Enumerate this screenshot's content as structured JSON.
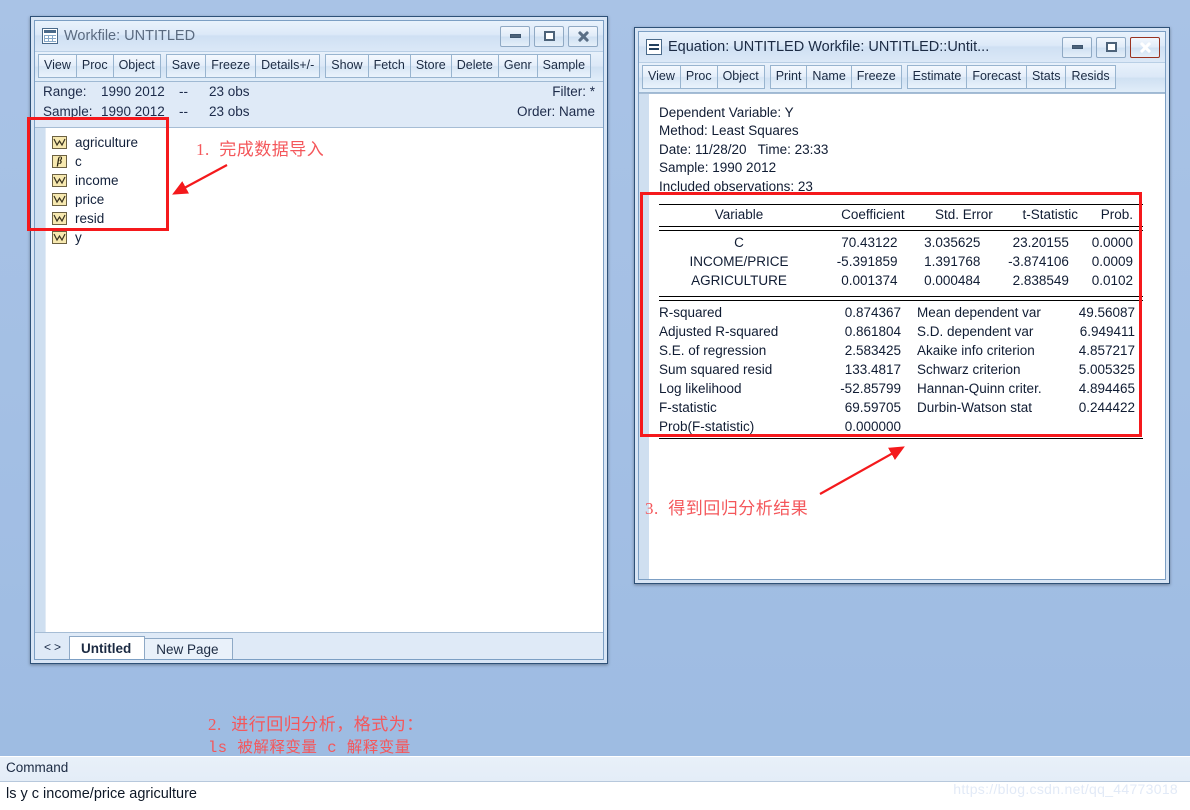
{
  "desktop": {
    "watermark": "https://blog.csdn.net/qq_44773018"
  },
  "workfile_window": {
    "title": "Workfile: UNTITLED",
    "icon": "grid-icon",
    "buttons": {
      "minimize": "minimize-icon",
      "maximize": "maximize-icon",
      "close": "close-icon"
    },
    "toolbar_group1": [
      "View",
      "Proc",
      "Object"
    ],
    "toolbar_group2": [
      "Save",
      "Freeze",
      "Details+/-"
    ],
    "toolbar_group3": [
      "Show",
      "Fetch",
      "Store",
      "Delete",
      "Genr",
      "Sample"
    ],
    "info": {
      "range_label": "Range:",
      "range_value": "1990 2012",
      "range_dash": "--",
      "range_obs": "23 obs",
      "filter_label": "Filter: *",
      "sample_label": "Sample:",
      "sample_value": "1990 2012",
      "sample_dash": "--",
      "sample_obs": "23 obs",
      "order_label": "Order: Name"
    },
    "objects": [
      {
        "name": "agriculture",
        "icon": "series-icon"
      },
      {
        "name": "c",
        "icon": "coefficient-beta-icon"
      },
      {
        "name": "income",
        "icon": "series-icon"
      },
      {
        "name": "price",
        "icon": "series-icon"
      },
      {
        "name": "resid",
        "icon": "series-icon"
      },
      {
        "name": "y",
        "icon": "series-icon"
      }
    ],
    "tabs": {
      "nav_prev": "<",
      "nav_next": ">",
      "items": [
        {
          "label": "Untitled",
          "selected": true
        },
        {
          "label": "New Page",
          "selected": false
        }
      ]
    }
  },
  "equation_window": {
    "title": "Equation: UNTITLED   Workfile: UNTITLED::Untit...",
    "icon": "equation-icon",
    "buttons": {
      "minimize": "minimize-icon",
      "maximize": "maximize-icon",
      "close": "close-icon"
    },
    "toolbar_group1": [
      "View",
      "Proc",
      "Object"
    ],
    "toolbar_group2": [
      "Print",
      "Name",
      "Freeze"
    ],
    "toolbar_group3": [
      "Estimate",
      "Forecast",
      "Stats",
      "Resids"
    ],
    "header_lines": [
      "Dependent Variable: Y",
      "Method: Least Squares",
      "Date: 11/28/20   Time: 23:33",
      "Sample: 1990 2012",
      "Included observations: 23"
    ],
    "regression": {
      "columns": [
        "Variable",
        "Coefficient",
        "Std. Error",
        "t-Statistic",
        "Prob."
      ],
      "rows": [
        {
          "variable": "C",
          "coefficient": "70.43122",
          "std_error": "3.035625",
          "t_statistic": "23.20155",
          "prob": "0.0000"
        },
        {
          "variable": "INCOME/PRICE",
          "coefficient": "-5.391859",
          "std_error": "1.391768",
          "t_statistic": "-3.874106",
          "prob": "0.0009"
        },
        {
          "variable": "AGRICULTURE",
          "coefficient": "0.001374",
          "std_error": "0.000484",
          "t_statistic": "2.838549",
          "prob": "0.0102"
        }
      ],
      "stats": [
        {
          "left_label": "R-squared",
          "left_value": "0.874367",
          "right_label": "Mean dependent var",
          "right_value": "49.56087"
        },
        {
          "left_label": "Adjusted R-squared",
          "left_value": "0.861804",
          "right_label": "S.D. dependent var",
          "right_value": "6.949411"
        },
        {
          "left_label": "S.E. of regression",
          "left_value": "2.583425",
          "right_label": "Akaike info criterion",
          "right_value": "4.857217"
        },
        {
          "left_label": "Sum squared resid",
          "left_value": "133.4817",
          "right_label": "Schwarz criterion",
          "right_value": "5.005325"
        },
        {
          "left_label": "Log likelihood",
          "left_value": "-52.85799",
          "right_label": "Hannan-Quinn criter.",
          "right_value": "4.894465"
        },
        {
          "left_label": "F-statistic",
          "left_value": "69.59705",
          "right_label": "Durbin-Watson stat",
          "right_value": "0.244422"
        },
        {
          "left_label": "Prob(F-statistic)",
          "left_value": "0.000000",
          "right_label": "",
          "right_value": ""
        }
      ]
    }
  },
  "command_pane": {
    "label": "Command",
    "value": "ls y c income/price agriculture"
  },
  "annotations": {
    "step1": "1.  完成数据导入",
    "step2_line1": "2.  进行回归分析，格式为：",
    "step2_line2": "ls 被解释变量 c 解释变量",
    "step3": "3.  得到回归分析结果",
    "color": "#f4575b",
    "box_color": "#f5191c"
  }
}
